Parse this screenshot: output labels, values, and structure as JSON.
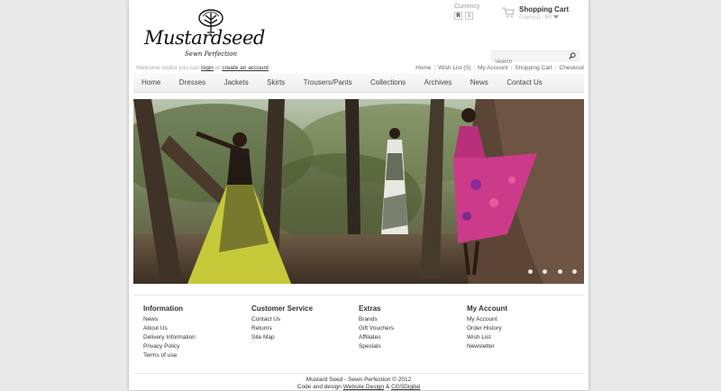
{
  "brand": {
    "name": "Mustardseed",
    "tagline": "Sewn Perfection"
  },
  "currency": {
    "label": "Currency",
    "options": [
      "R",
      "$"
    ],
    "selected": "R"
  },
  "cart": {
    "title": "Shopping Cart",
    "summary": "0 item(s) - R0"
  },
  "search": {
    "placeholder": "Search"
  },
  "welcome": {
    "prefix": "Welcome visitor you can",
    "login": "login",
    "or": "or",
    "create": "create an account"
  },
  "toplinks": [
    "Home",
    "Wish List (0)",
    "My Account",
    "Shopping Cart",
    "Checkout"
  ],
  "nav": [
    "Home",
    "Dresses",
    "Jackets",
    "Skirts",
    "Trousers/Pants",
    "Collections",
    "Archives",
    "News",
    "Contact Us"
  ],
  "banner": {
    "slide_count": 4
  },
  "footer": {
    "columns": [
      {
        "title": "Information",
        "links": [
          "News",
          "About Us",
          "Delivery Information",
          "Privacy Policy",
          "Terms of use"
        ]
      },
      {
        "title": "Customer Service",
        "links": [
          "Contact Us",
          "Returns",
          "Site Map"
        ]
      },
      {
        "title": "Extras",
        "links": [
          "Brands",
          "Gift Vouchers",
          "Affiliates",
          "Specials"
        ]
      },
      {
        "title": "My Account",
        "links": [
          "My Account",
          "Order History",
          "Wish List",
          "Newsletter"
        ]
      }
    ]
  },
  "credits": {
    "line1": "Mustard Seed - Sewn Perfection © 2012",
    "line2_prefix": "Code and design",
    "link1": "Website Design",
    "amp": "&",
    "link2": "CGSDigital"
  }
}
